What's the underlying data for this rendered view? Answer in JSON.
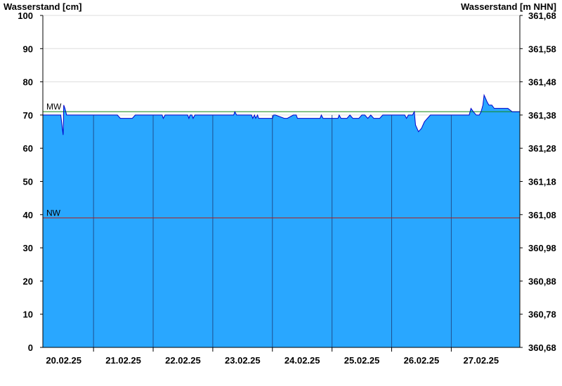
{
  "chart_data": {
    "type": "area",
    "ylabel_left": "Wasserstand [cm]",
    "ylabel_right": "Wasserstand [m NHN]",
    "ylim": [
      0,
      100
    ],
    "yticks_left": [
      "0",
      "10",
      "20",
      "30",
      "40",
      "50",
      "60",
      "70",
      "80",
      "90",
      "100"
    ],
    "yticks_right": [
      "360,68",
      "360,78",
      "360,88",
      "360,98",
      "361,08",
      "361,18",
      "361,28",
      "361,38",
      "361,48",
      "361,58",
      "361,68"
    ],
    "categories": [
      "20.02.25",
      "21.02.25",
      "22.02.25",
      "23.02.25",
      "24.02.25",
      "25.02.25",
      "26.02.25",
      "27.02.25"
    ],
    "xlim": [
      -0.35,
      7.65
    ],
    "grid": true,
    "series": [
      {
        "x": [
          -0.35,
          -0.05,
          -0.03,
          -0.01,
          0.0,
          0.02,
          0.05,
          0.1,
          0.9,
          0.95,
          1.15,
          1.2,
          1.65,
          1.67,
          1.7,
          2.08,
          2.1,
          2.12,
          2.15,
          2.17,
          2.2,
          2.85,
          2.87,
          2.9,
          3.15,
          3.17,
          3.2,
          3.22,
          3.25,
          3.27,
          3.3,
          3.5,
          3.52,
          3.55,
          3.7,
          3.75,
          3.85,
          3.9,
          3.92,
          3.95,
          4.3,
          4.32,
          4.35,
          4.6,
          4.62,
          4.65,
          4.75,
          4.8,
          4.85,
          4.95,
          5.0,
          5.05,
          5.1,
          5.15,
          5.2,
          5.3,
          5.35,
          5.72,
          5.75,
          5.78,
          5.85,
          5.88,
          5.9,
          5.95,
          6.0,
          6.05,
          6.1,
          6.15,
          6.8,
          6.83,
          6.87,
          6.92,
          6.97,
          7.0,
          7.03,
          7.05,
          7.1,
          7.13,
          7.18,
          7.22,
          7.3,
          7.45,
          7.52,
          7.65
        ],
        "values": [
          70,
          70,
          67,
          64,
          73,
          72,
          70,
          70,
          70,
          69,
          69,
          70,
          70,
          69,
          70,
          70,
          69,
          70,
          70,
          69,
          70,
          70,
          71,
          70,
          70,
          69,
          70,
          69,
          70,
          69,
          69,
          69,
          70,
          70,
          69,
          69,
          70,
          70,
          69,
          69,
          69,
          70,
          69,
          69,
          70,
          69,
          69,
          70,
          69,
          69,
          70,
          70,
          69,
          70,
          69,
          69,
          70,
          70,
          69,
          70,
          70,
          71,
          67,
          65,
          66,
          68,
          69,
          70,
          70,
          72,
          71,
          70,
          70,
          71,
          73,
          76,
          74,
          73,
          73,
          72,
          72,
          72,
          71,
          71
        ]
      }
    ],
    "ref_lines": [
      {
        "label": "MW",
        "value": 71,
        "color": "#118811"
      },
      {
        "label": "NW",
        "value": 39,
        "color": "#aa2222"
      }
    ],
    "colors": {
      "fill": "#29a7ff",
      "line": "#0000cc",
      "grid": "#dddddd",
      "day_sep": "#1f4f8f"
    }
  }
}
